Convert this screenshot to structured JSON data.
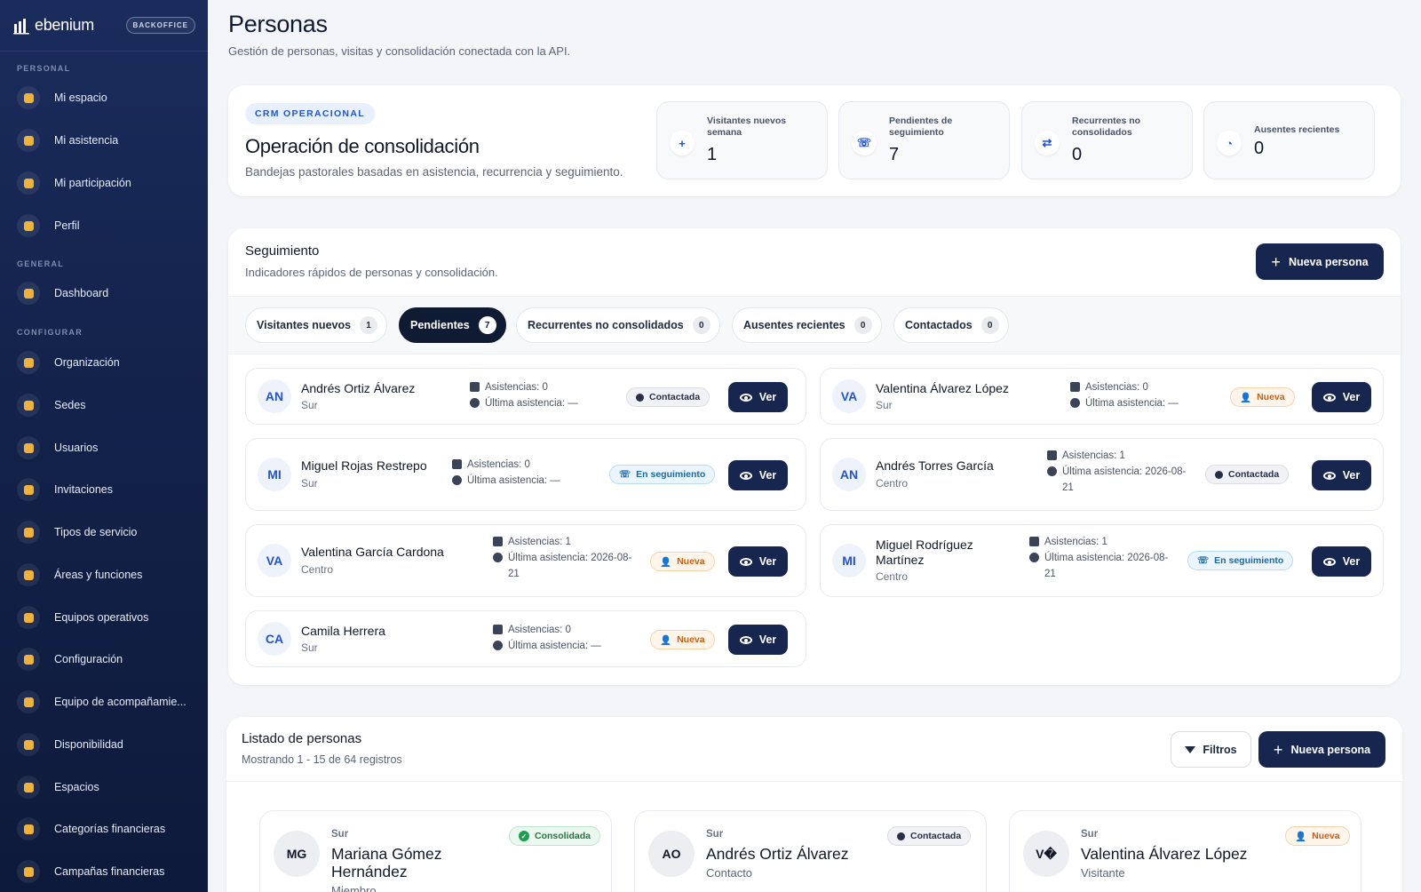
{
  "sidebar": {
    "brand": "ebenium",
    "badge": "BACKOFFICE",
    "sections": {
      "personal": "PERSONAL",
      "general": "GENERAL",
      "configurar": "CONFIGURAR"
    },
    "items": [
      {
        "label": "Mi espacio",
        "icon": "home-icon"
      },
      {
        "label": "Mi asistencia",
        "icon": "calendar-check-icon"
      },
      {
        "label": "Mi participación",
        "icon": "people-icon"
      },
      {
        "label": "Perfil",
        "icon": "user-circle-icon"
      },
      {
        "label": "Dashboard",
        "icon": "home-icon"
      },
      {
        "label": "Organización",
        "icon": "building-icon"
      },
      {
        "label": "Sedes",
        "icon": "building-small-icon"
      },
      {
        "label": "Usuarios",
        "icon": "users-icon"
      },
      {
        "label": "Invitaciones",
        "icon": "invite-icon"
      },
      {
        "label": "Tipos de servicio",
        "icon": "tag-icon"
      },
      {
        "label": "Áreas y funciones",
        "icon": "sitemap-icon"
      },
      {
        "label": "Equipos operativos",
        "icon": "team-icon"
      },
      {
        "label": "Configuración",
        "icon": "sliders-icon"
      },
      {
        "label": "Equipo de acompañamie...",
        "icon": "hands-icon"
      },
      {
        "label": "Disponibilidad",
        "icon": "calendar-icon"
      },
      {
        "label": "Espacios",
        "icon": "door-icon"
      },
      {
        "label": "Categorías financieras",
        "icon": "tag-icon"
      },
      {
        "label": "Campañas financieras",
        "icon": "target-icon"
      }
    ]
  },
  "header": {
    "title": "Personas",
    "subtitle": "Gestión de personas, visitas y consolidación conectada con la API."
  },
  "crm": {
    "tag": "CRM OPERACIONAL",
    "title": "Operación de consolidación",
    "description": "Bandejas pastorales basadas en asistencia, recurrencia y seguimiento.",
    "stats": [
      {
        "label": "Visitantes nuevos semana",
        "value": "1",
        "icon": "user-plus-icon"
      },
      {
        "label": "Pendientes de seguimiento",
        "value": "7",
        "icon": "phone-icon"
      },
      {
        "label": "Recurrentes no consolidados",
        "value": "0",
        "icon": "repeat-icon"
      },
      {
        "label": "Ausentes recientes",
        "value": "0",
        "icon": "user-clock-icon"
      }
    ]
  },
  "seguimiento": {
    "title": "Seguimiento",
    "subtitle": "Indicadores rápidos de personas y consolidación.",
    "new_button": "Nueva persona",
    "tabs": [
      {
        "label": "Visitantes nuevos",
        "count": "1"
      },
      {
        "label": "Pendientes",
        "count": "7"
      },
      {
        "label": "Recurrentes no consolidados",
        "count": "0"
      },
      {
        "label": "Ausentes recientes",
        "count": "0"
      },
      {
        "label": "Contactados",
        "count": "0"
      }
    ],
    "view_label": "Ver",
    "people": [
      {
        "initials": "AN",
        "name": "Andrés Ortiz Álvarez",
        "branch": "Sur",
        "asist": "Asistencias: 0",
        "ultima": "Última asistencia: —",
        "status": "Contactada"
      },
      {
        "initials": "VA",
        "name": "Valentina Álvarez López",
        "branch": "Sur",
        "asist": "Asistencias: 0",
        "ultima": "Última asistencia: —",
        "status": "Nueva"
      },
      {
        "initials": "MI",
        "name": "Miguel Rojas Restrepo",
        "branch": "Sur",
        "asist": "Asistencias: 0",
        "ultima": "Última asistencia: —",
        "status": "En seguimiento"
      },
      {
        "initials": "AN",
        "name": "Andrés Torres García",
        "branch": "Centro",
        "asist": "Asistencias: 1",
        "ultima": "Última asistencia: 2026-08-21",
        "status": "Contactada"
      },
      {
        "initials": "VA",
        "name": "Valentina García Cardona",
        "branch": "Centro",
        "asist": "Asistencias: 1",
        "ultima": "Última asistencia: 2026-08-21",
        "status": "Nueva"
      },
      {
        "initials": "MI",
        "name": "Miguel Rodríguez Martínez",
        "branch": "Centro",
        "asist": "Asistencias: 1",
        "ultima": "Última asistencia: 2026-08-21",
        "status": "En seguimiento"
      },
      {
        "initials": "CA",
        "name": "Camila Herrera",
        "branch": "Sur",
        "asist": "Asistencias: 0",
        "ultima": "Última asistencia: —",
        "status": "Nueva"
      }
    ]
  },
  "listado": {
    "title": "Listado de personas",
    "subtitle": "Mostrando 1 - 15 de 64 registros",
    "filters_button": "Filtros",
    "new_button": "Nueva persona",
    "cards": [
      {
        "initials": "MG",
        "sede": "Sur",
        "name": "Mariana Gómez Hernández",
        "role": "Miembro",
        "status": "Consolidada"
      },
      {
        "initials": "AO",
        "sede": "Sur",
        "name": "Andrés Ortiz Álvarez",
        "role": "Contacto",
        "status": "Contactada"
      },
      {
        "initials": "V�",
        "sede": "Sur",
        "name": "Valentina Álvarez López",
        "role": "Visitante",
        "status": "Nueva"
      }
    ]
  }
}
